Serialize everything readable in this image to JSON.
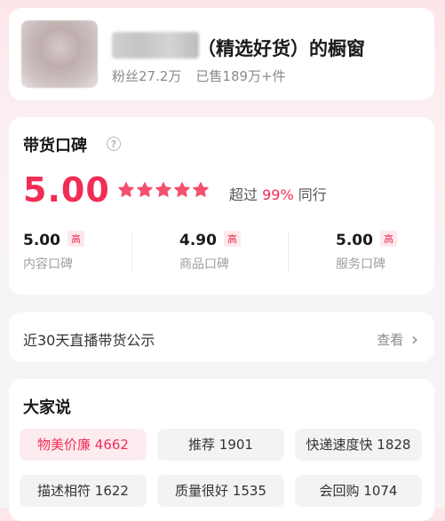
{
  "shop": {
    "name_suffix": "（精选好货）的橱窗",
    "fans": "粉丝27.2万",
    "sold": "已售189万+件"
  },
  "rating": {
    "title": "带货口碑",
    "help_icon": "?",
    "score": "5.00",
    "stars": 5,
    "beat_prefix": "超过",
    "beat_pct": "99%",
    "beat_suffix": "同行",
    "subs": [
      {
        "value": "5.00",
        "tag": "高",
        "label": "内容口碑"
      },
      {
        "value": "4.90",
        "tag": "高",
        "label": "商品口碑"
      },
      {
        "value": "5.00",
        "tag": "高",
        "label": "服务口碑"
      }
    ]
  },
  "live": {
    "title": "近30天直播带货公示",
    "more": "查看",
    "chevron": "›"
  },
  "say": {
    "title": "大家说",
    "chips": [
      "物美价廉 4662",
      "推荐 1901",
      "快递速度快 1828",
      "描述相符 1622",
      "质量很好 1535",
      "会回购 1074"
    ]
  },
  "colors": {
    "accent": "#f02d55",
    "tag_bg": "#fde8ec"
  }
}
